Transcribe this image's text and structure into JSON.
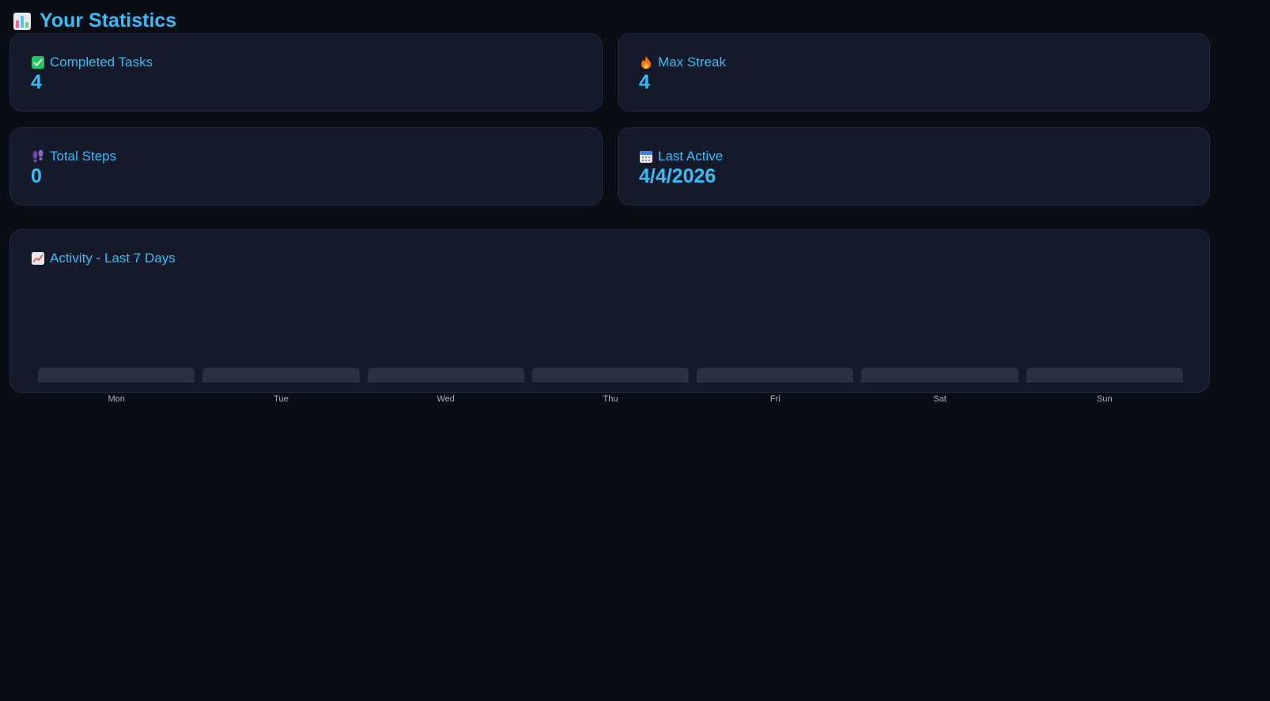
{
  "page": {
    "title": "Your Statistics",
    "title_icon": "bar-chart-icon"
  },
  "stats": {
    "completed_tasks": {
      "label": "Completed Tasks",
      "value": "4",
      "icon": "check-box-icon"
    },
    "max_streak": {
      "label": "Max Streak",
      "value": "4",
      "icon": "fire-icon"
    },
    "total_steps": {
      "label": "Total Steps",
      "value": "0",
      "icon": "footprints-icon"
    },
    "last_active": {
      "label": "Last Active",
      "value": "4/4/2026",
      "icon": "calendar-icon"
    }
  },
  "activity": {
    "title": "Activity - Last 7 Days",
    "icon": "trend-chart-icon"
  },
  "chart_data": {
    "type": "bar",
    "categories": [
      "Mon",
      "Tue",
      "Wed",
      "Thu",
      "Fri",
      "Sat",
      "Sun"
    ],
    "values": [
      0,
      0,
      0,
      0,
      0,
      0,
      0
    ],
    "title": "Activity - Last 7 Days"
  },
  "colors": {
    "background": "#090d16",
    "card": "#141a2a",
    "accent": "#38bdf8",
    "bar": "#2a3040",
    "muted_text": "#a8b0c0"
  }
}
